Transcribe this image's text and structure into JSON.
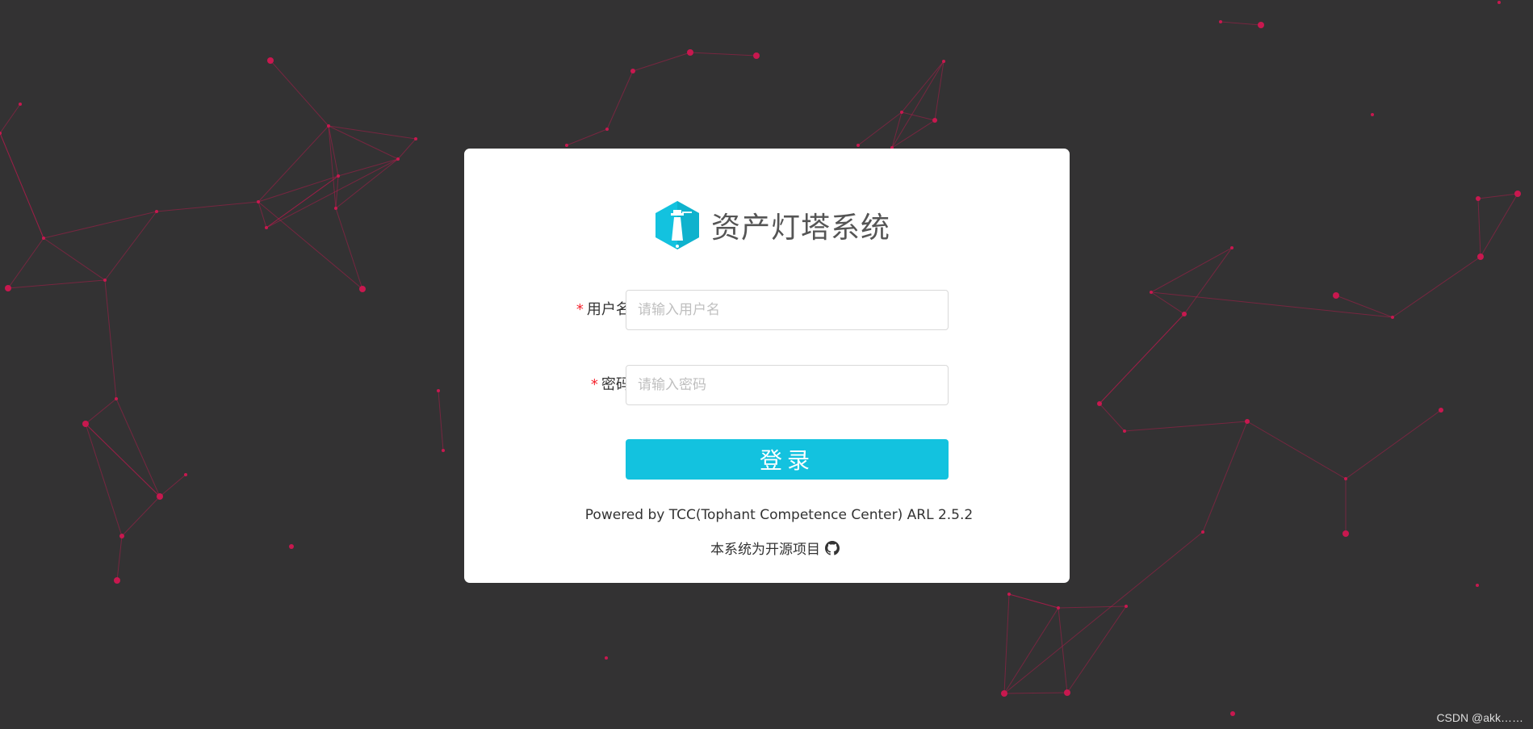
{
  "brand": {
    "title": "资产灯塔系统",
    "logo_icon": "lighthouse-hexagon-icon",
    "accent_color": "#13c2df"
  },
  "form": {
    "username": {
      "label": "用户名:",
      "placeholder": "请输入用户名",
      "value": "",
      "required_mark": "*"
    },
    "password": {
      "label": "密码:",
      "placeholder": "请输入密码",
      "value": "",
      "required_mark": "*"
    },
    "submit_label": "登录"
  },
  "footer": {
    "powered_by": "Powered by TCC(Tophant Competence Center) ARL 2.5.2",
    "open_source": "本系统为开源项目",
    "github_icon": "github-icon"
  },
  "watermark": "CSDN @akk……",
  "colors": {
    "background": "#333233",
    "network": "#c8184f",
    "required": "#f5222d"
  }
}
